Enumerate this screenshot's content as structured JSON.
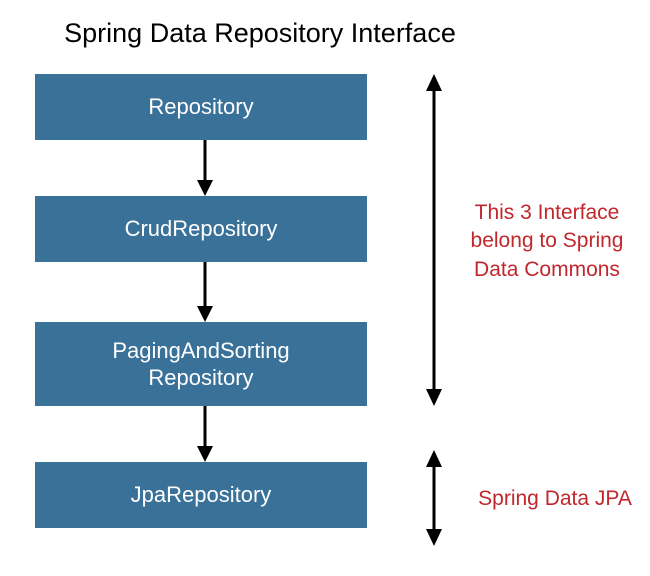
{
  "title": "Spring Data Repository Interface",
  "boxes": {
    "repository": "Repository",
    "crud": "CrudRepository",
    "paging": "PagingAndSorting\nRepository",
    "jpa": "JpaRepository"
  },
  "annotations": {
    "commons": "This 3 Interface belong to Spring Data Commons",
    "jpa": "Spring Data JPA"
  },
  "colors": {
    "box_bg": "#3a7198",
    "box_text": "#ffffff",
    "annotation": "#c1272d"
  }
}
